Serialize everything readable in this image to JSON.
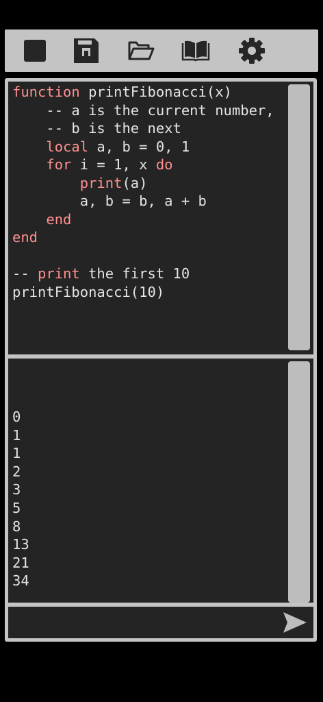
{
  "toolbar": {
    "buttons": [
      {
        "icon": "stop-icon"
      },
      {
        "icon": "save-icon"
      },
      {
        "icon": "folder-open-icon"
      },
      {
        "icon": "book-icon"
      },
      {
        "icon": "gear-icon"
      }
    ]
  },
  "editor": {
    "lines": [
      [
        {
          "t": "function",
          "k": 1
        },
        {
          "t": " printFibonacci(x)"
        }
      ],
      [
        {
          "t": "    -- a is the current number,"
        }
      ],
      [
        {
          "t": "    -- b is the next"
        }
      ],
      [
        {
          "t": "    "
        },
        {
          "t": "local",
          "k": 1
        },
        {
          "t": " a, b = 0, 1"
        }
      ],
      [
        {
          "t": "    "
        },
        {
          "t": "for",
          "k": 1
        },
        {
          "t": " i = 1, x "
        },
        {
          "t": "do",
          "k": 1
        }
      ],
      [
        {
          "t": "        "
        },
        {
          "t": "print",
          "k": 1
        },
        {
          "t": "(a)"
        }
      ],
      [
        {
          "t": "        a, b = b, a + b"
        }
      ],
      [
        {
          "t": "    "
        },
        {
          "t": "end",
          "k": 1
        }
      ],
      [
        {
          "t": "end",
          "k": 1
        }
      ],
      [
        {
          "t": ""
        }
      ],
      [
        {
          "t": "-- "
        },
        {
          "t": "print",
          "k": 1
        },
        {
          "t": " the first 10"
        }
      ],
      [
        {
          "t": "printFibonacci(10)"
        }
      ]
    ]
  },
  "console": {
    "output": [
      "0",
      "1",
      "1",
      "2",
      "3",
      "5",
      "8",
      "13",
      "21",
      "34"
    ]
  },
  "input": {
    "value": "",
    "placeholder": ""
  },
  "colors": {
    "keyword": "#ff8f8f",
    "text": "#e4e4e4",
    "panel": "#242424",
    "chrome": "#c4c4c4"
  }
}
